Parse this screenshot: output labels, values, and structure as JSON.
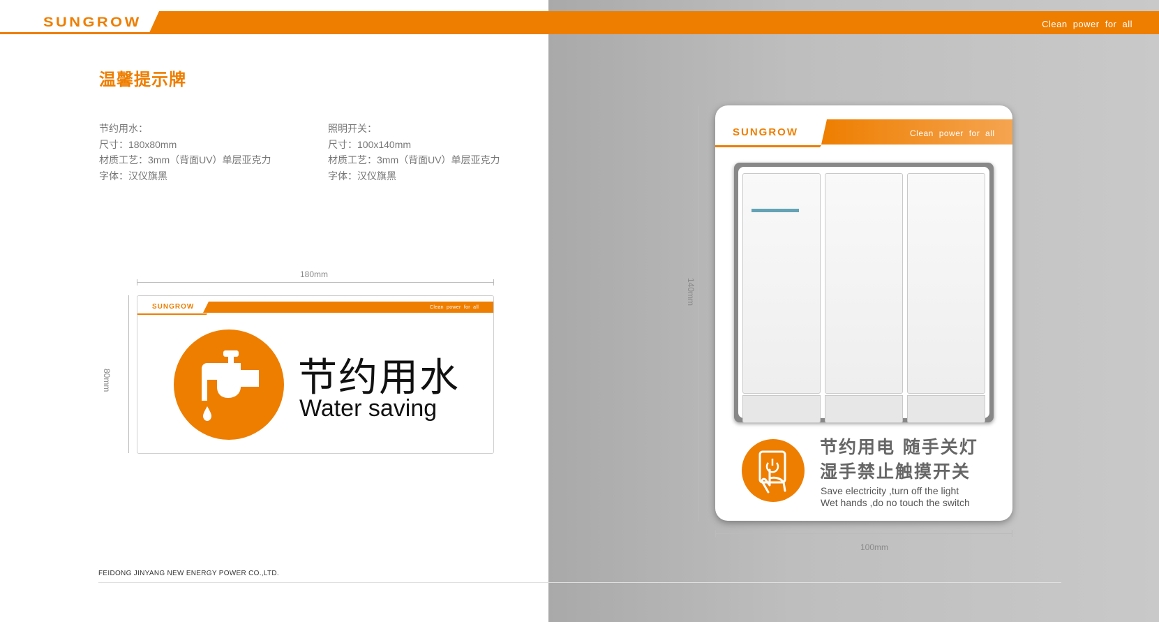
{
  "header": {
    "brand": "SUNGROW",
    "tagline": "Clean power for all"
  },
  "page_title": "温馨提示牌",
  "spec_left": [
    "节约用水：",
    "尺寸：180x80mm",
    "材质工艺：3mm（背面UV）单层亚克力",
    "字体：汉仪旗黑"
  ],
  "spec_right": [
    "照明开关：",
    "尺寸：100x140mm",
    "材质工艺：3mm（背面UV）单层亚克力",
    "字体：汉仪旗黑"
  ],
  "water_sign": {
    "width_label": "180mm",
    "height_label": "80mm",
    "brand": "SUNGROW",
    "tagline": "Clean power for all",
    "title_cn": "节约用水",
    "title_en": "Water saving"
  },
  "switch_sign": {
    "width_label": "100mm",
    "height_label": "140mm",
    "brand": "SUNGROW",
    "tagline": "Clean power for all",
    "line1_cn": "节约用电  随手关灯",
    "line2_cn": "湿手禁止触摸开关",
    "line1_en": "Save electricity ,turn off the light",
    "line2_en": "Wet hands ,do no touch the switch"
  },
  "footer": {
    "company": "FEIDONG JINYANG NEW ENERGY POWER CO.,LTD."
  },
  "colors": {
    "brand_orange": "#ee7e00",
    "panel_grey": "#bebebe"
  }
}
